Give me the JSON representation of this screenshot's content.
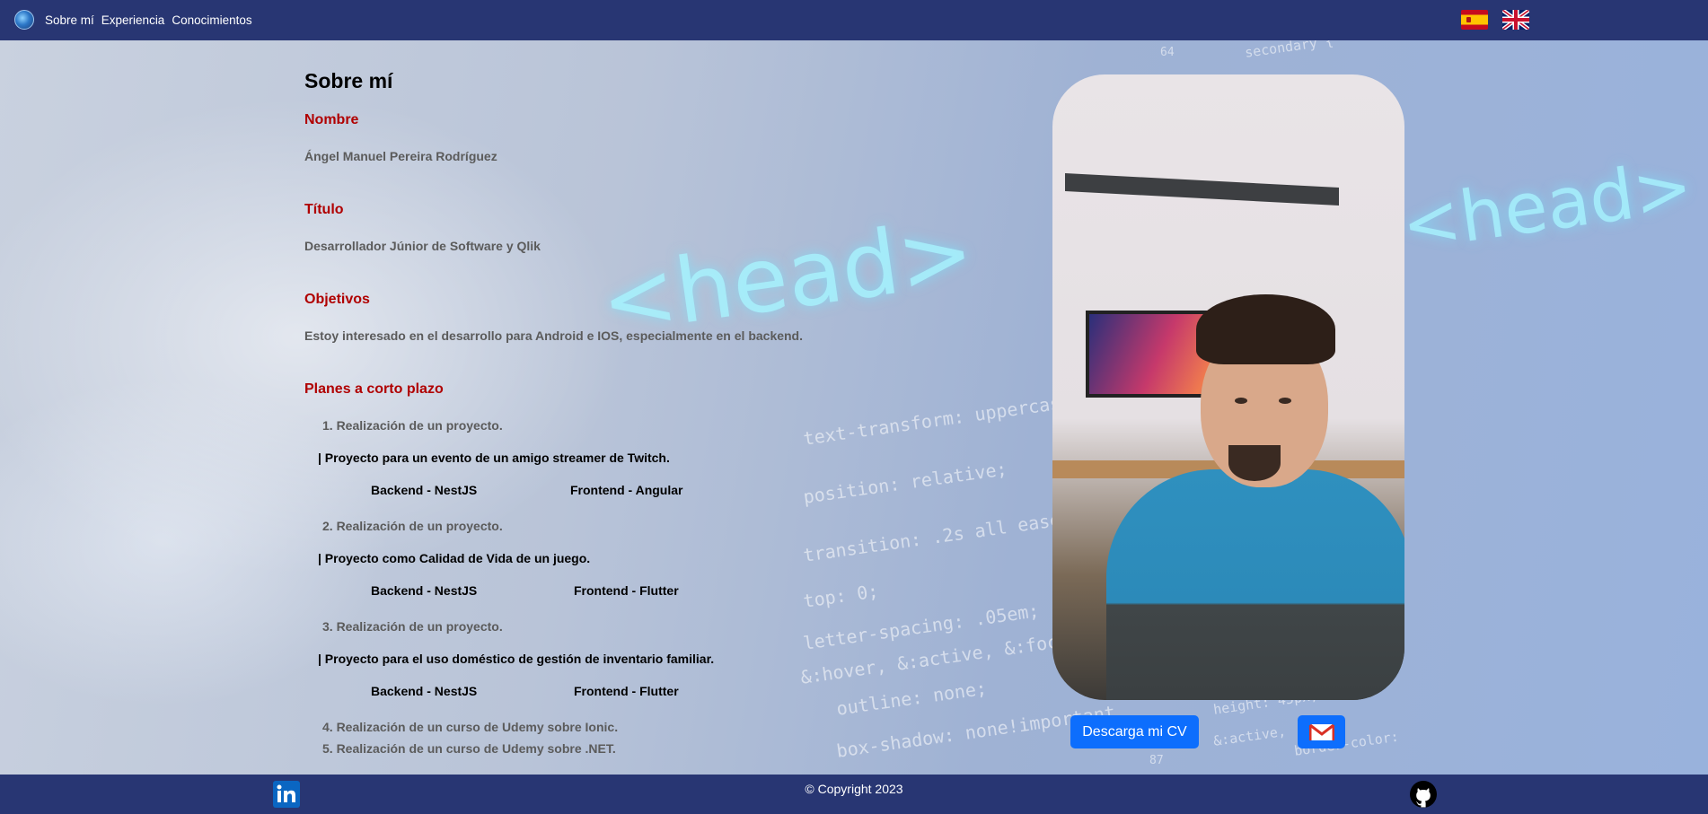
{
  "nav": {
    "logo_icon": "globe-logo-icon",
    "links": [
      "Sobre mí",
      "Experiencia",
      "Conocimientos"
    ],
    "languages": [
      {
        "icon": "spain-flag-icon",
        "code": "es"
      },
      {
        "icon": "uk-flag-icon",
        "code": "en"
      }
    ]
  },
  "about": {
    "title": "Sobre mí",
    "name_label": "Nombre",
    "name_value": "Ángel Manuel Pereira Rodríguez",
    "title_label": "Título",
    "title_value": "Desarrollador Júnior de Software y Qlik",
    "goals_label": "Objetivos",
    "goals_value": "Estoy interesado en el desarrollo para Android e IOS, especialmente en el backend.",
    "plans_label": "Planes a corto plazo",
    "plans": [
      {
        "item": "1. Realización de un proyecto.",
        "desc": "| Proyecto para un evento de un amigo streamer de Twitch.",
        "backend": "Backend - NestJS",
        "frontend": "Frontend - Angular"
      },
      {
        "item": "2. Realización de un proyecto.",
        "desc": "| Proyecto como Calidad de Vida de un juego.",
        "backend": "Backend - NestJS",
        "frontend": "Frontend - Flutter"
      },
      {
        "item": "3. Realización de un proyecto.",
        "desc": "| Proyecto para el uso doméstico de gestión de inventario familiar.",
        "backend": "Backend - NestJS",
        "frontend": "Frontend - Flutter"
      }
    ],
    "extra_plans": [
      "4. Realización de un curso de Udemy sobre Ionic.",
      "5. Realización de un curso de Udemy sobre .NET."
    ]
  },
  "actions": {
    "download_cv": "Descarga mi CV",
    "mail_icon": "gmail-icon"
  },
  "background_code": [
    "text-transform: uppercase;",
    "position: relative;",
    "transition: .2s all ease-in",
    "top: 0;",
    "letter-spacing: .05em;",
    "&:hover, &:active, &:focus",
    "outline: none;",
    "box-shadow: none!important",
    "height: 45px;",
    "&:active,",
    "border-color:",
    "<head>",
    "<head>",
    "64",
    "87",
    "secondary {"
  ],
  "footer": {
    "copyright": "© Copyright 2023",
    "linkedin_icon": "linkedin-icon",
    "github_icon": "github-icon"
  },
  "colors": {
    "nav_bg": "#283673",
    "accent_red": "#b00000",
    "button_blue": "#0d6efd"
  }
}
